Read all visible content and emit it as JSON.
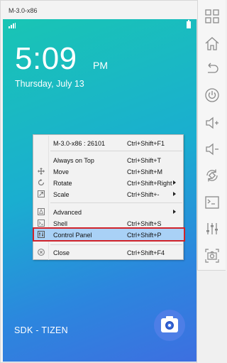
{
  "window": {
    "title": "M-3.0-x86"
  },
  "lockscreen": {
    "time": "5:09",
    "ampm": "PM",
    "date": "Thursday, July 13",
    "footer_label": "SDK - TIZEN"
  },
  "context_menu": {
    "items": [
      {
        "id": "device",
        "label": "M-3.0-x86 : 26101",
        "shortcut": "Ctrl+Shift+F1",
        "icon": "none"
      },
      {
        "id": "always-on-top",
        "label": "Always on Top",
        "shortcut": "Ctrl+Shift+T",
        "icon": "none"
      },
      {
        "id": "move",
        "label": "Move",
        "shortcut": "Ctrl+Shift+M",
        "icon": "move-icon"
      },
      {
        "id": "rotate",
        "label": "Rotate",
        "shortcut": "Ctrl+Shift+Right",
        "icon": "rotate-icon",
        "submenu": true
      },
      {
        "id": "scale",
        "label": "Scale",
        "shortcut": "Ctrl+Shift+-",
        "icon": "scale-icon",
        "submenu": true
      },
      {
        "id": "advanced",
        "label": "Advanced",
        "shortcut": "",
        "icon": "advanced-icon",
        "submenu": true
      },
      {
        "id": "shell",
        "label": "Shell",
        "shortcut": "Ctrl+Shift+S",
        "icon": "shell-icon"
      },
      {
        "id": "control-panel",
        "label": "Control Panel",
        "shortcut": "Ctrl+Shift+P",
        "icon": "control-panel-icon",
        "highlighted": true
      },
      {
        "id": "close",
        "label": "Close",
        "shortcut": "Ctrl+Shift+F4",
        "icon": "close-icon"
      }
    ]
  },
  "toolbar": {
    "buttons": [
      "grid-icon",
      "home-icon",
      "back-icon",
      "power-icon",
      "volume-up-icon",
      "volume-down-icon",
      "rotate-screen-icon",
      "shell-icon",
      "control-panel-icon",
      "screenshot-icon"
    ]
  },
  "colors": {
    "menu_highlight": "#a9d1f6",
    "highlight_outline": "#d1232a",
    "screen_gradient_start": "#19c5b4",
    "screen_gradient_end": "#3d6fe0"
  }
}
